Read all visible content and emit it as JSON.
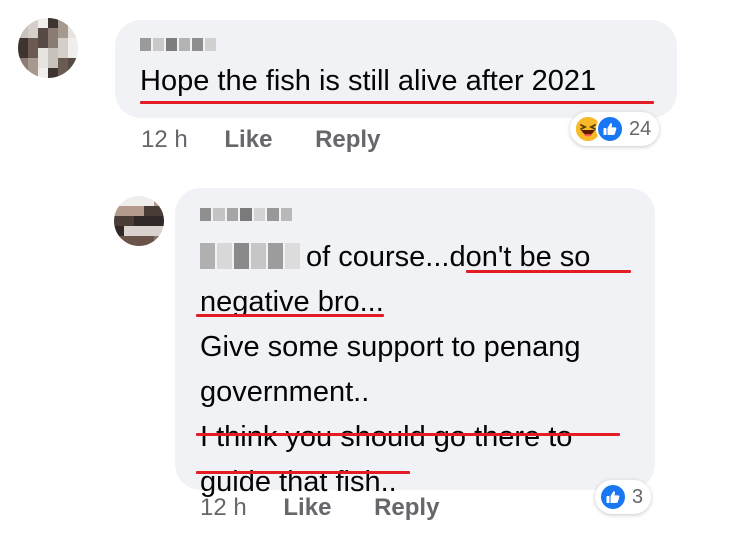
{
  "comments": [
    {
      "text": "Hope the fish is still alive after 2021",
      "time": "12 h",
      "like_label": "Like",
      "reply_label": "Reply",
      "reaction_count": "24",
      "reaction_icons": [
        "haha-icon",
        "like-icon"
      ]
    },
    {
      "text": "of course...don't be so",
      "text_lines": [
        "negative bro...",
        "Give some support to penang",
        "government..",
        "I think you should go there to",
        "guide that fish.."
      ],
      "time": "12 h",
      "like_label": "Like",
      "reply_label": "Reply",
      "reaction_count": "3",
      "reaction_icons": [
        "like-icon"
      ]
    }
  ],
  "colors": {
    "bubble": "#f0f2f5",
    "underline": "#e41c23",
    "meta": "#65676b",
    "like_blue": "#1877f2",
    "haha_yellow": "#f7b928"
  }
}
